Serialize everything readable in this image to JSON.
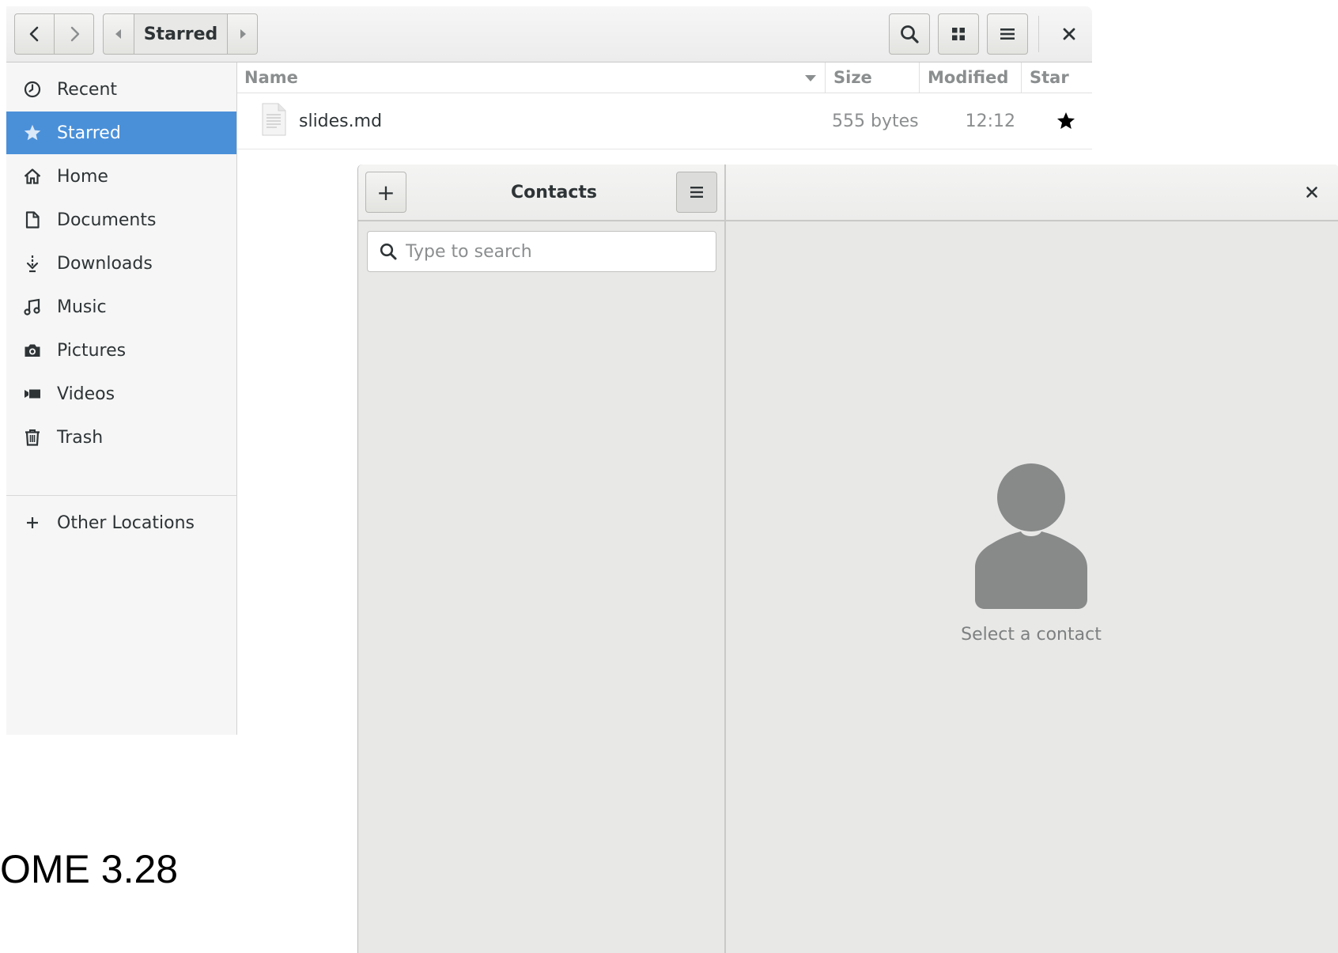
{
  "background": {
    "text": "OME 3.28"
  },
  "files": {
    "path_label": "Starred",
    "sidebar": {
      "items": [
        {
          "label": "Recent",
          "icon": "clock-icon"
        },
        {
          "label": "Starred",
          "icon": "star-icon",
          "selected": true
        },
        {
          "label": "Home",
          "icon": "home-icon"
        },
        {
          "label": "Documents",
          "icon": "document-icon"
        },
        {
          "label": "Downloads",
          "icon": "download-icon"
        },
        {
          "label": "Music",
          "icon": "music-icon"
        },
        {
          "label": "Pictures",
          "icon": "camera-icon"
        },
        {
          "label": "Videos",
          "icon": "video-icon"
        },
        {
          "label": "Trash",
          "icon": "trash-icon"
        }
      ],
      "other_locations": "Other Locations"
    },
    "columns": {
      "name": "Name",
      "size": "Size",
      "modified": "Modified",
      "star": "Star"
    },
    "rows": [
      {
        "name": "slides.md",
        "size": "555 bytes",
        "modified": "12:12",
        "starred": true
      }
    ],
    "colors": {
      "selection": "#4a90d9"
    }
  },
  "contacts": {
    "title": "Contacts",
    "add_label": "+",
    "search_placeholder": "Type to search",
    "empty_text": "Select a contact"
  }
}
